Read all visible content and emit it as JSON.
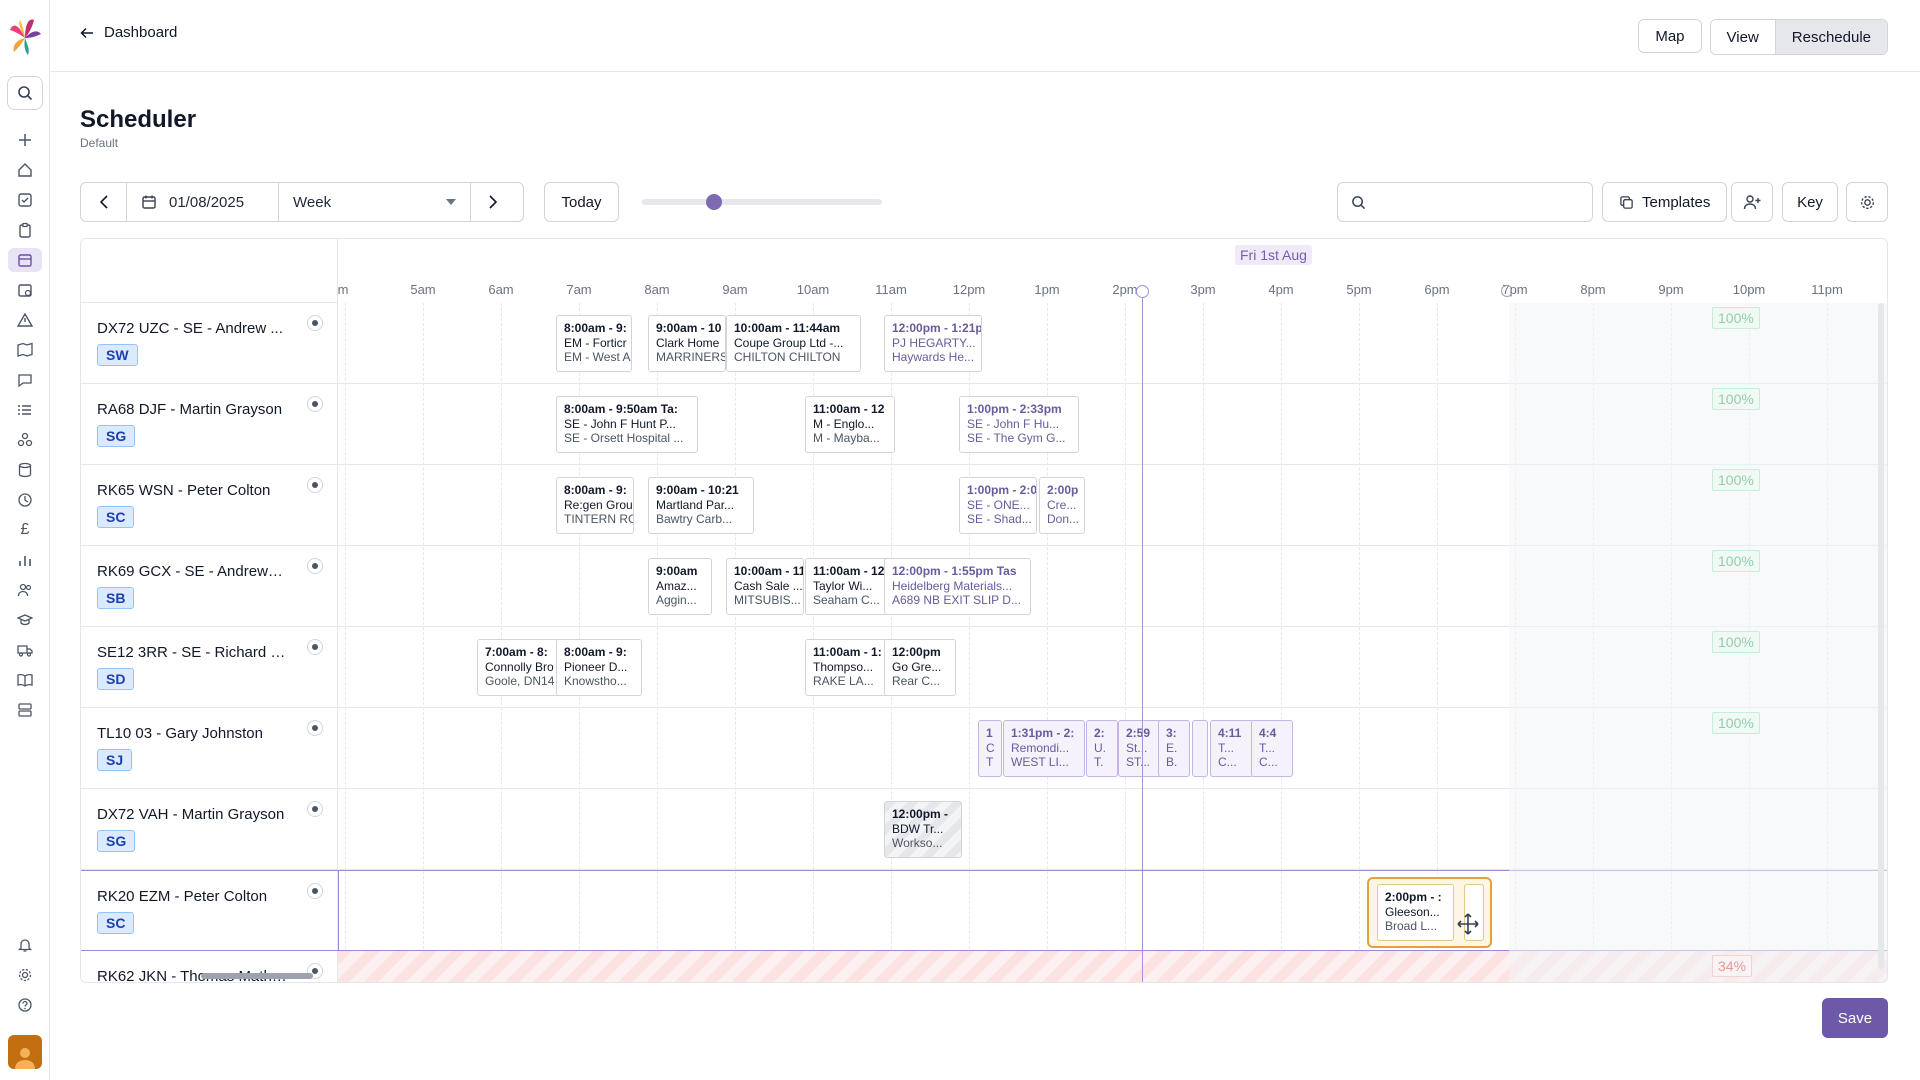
{
  "topbar": {
    "back_label": "Dashboard",
    "buttons": [
      "Map",
      "View",
      "Reschedule"
    ],
    "active_button": "Reschedule"
  },
  "page": {
    "title": "Scheduler",
    "subtitle": "Default"
  },
  "toolbar": {
    "date": "01/08/2025",
    "view_select": "Week",
    "today_label": "Today",
    "zoom_fraction": 0.3,
    "search_placeholder": "",
    "templates_label": "Templates",
    "key_label": "Key"
  },
  "timeline": {
    "day_label": "Fri 1st Aug",
    "hours": [
      "m",
      "5am",
      "6am",
      "7am",
      "8am",
      "9am",
      "10am",
      "11am",
      "12pm",
      "1pm",
      "2pm",
      "3pm",
      "4pm",
      "5pm",
      "6pm",
      "7pm",
      "8pm",
      "9pm",
      "10pm",
      "11pm"
    ]
  },
  "rows": [
    {
      "name": "DX72 UZC - SE - Andrew ...",
      "badge": "SW",
      "utilisation": "100%",
      "jobs": [
        {
          "t": "8:00am - 9:",
          "l2": "EM - Forticr",
          "l3": "EM - West A"
        },
        {
          "t": "9:00am - 10",
          "l2": "Clark Home",
          "l3": "MARRINERS"
        },
        {
          "t": "10:00am - 11:44am",
          "l2": "Coupe Group Ltd -...",
          "l3": "CHILTON CHILTON"
        },
        {
          "t": "12:00pm - 1:21p",
          "l2": "PJ HEGARTY...",
          "l3": "Haywards He..."
        }
      ]
    },
    {
      "name": "RA68 DJF - Martin Grayson",
      "badge": "SG",
      "utilisation": "100%",
      "jobs": [
        {
          "t": "8:00am - 9:50am  Ta:",
          "l2": "SE - John F Hunt P...",
          "l3": "SE - Orsett Hospital ..."
        },
        {
          "t": "11:00am - 12",
          "l2": "M - Englo...",
          "l3": "M - Mayba..."
        },
        {
          "t": "1:00pm - 2:33pm",
          "l2": "SE - John F Hu...",
          "l3": "SE - The Gym G..."
        }
      ]
    },
    {
      "name": "RK65 WSN - Peter Colton",
      "badge": "SC",
      "utilisation": "100%",
      "jobs": [
        {
          "t": "8:00am - 9:",
          "l2": "Re:gen Grou",
          "l3": "TINTERN RC"
        },
        {
          "t": "9:00am - 10:21",
          "l2": "Martland Par...",
          "l3": "Bawtry Carb..."
        },
        {
          "t": "1:00pm - 2:0",
          "l2": "SE - ONE...",
          "l3": "SE - Shad..."
        },
        {
          "t": "2:00p",
          "l2": "Cre...",
          "l3": "Don..."
        }
      ]
    },
    {
      "name": "RK69 GCX - SE - Andrew B...",
      "badge": "SB",
      "utilisation": "100%",
      "jobs": [
        {
          "t": "9:00am",
          "l2": "Amaz...",
          "l3": "Aggin..."
        },
        {
          "t": "10:00am - 11",
          "l2": "Cash Sale ...",
          "l3": "MITSUBIS..."
        },
        {
          "t": "11:00am - 12",
          "l2": "Taylor Wi...",
          "l3": "Seaham C..."
        },
        {
          "t": "12:00pm - 1:55pm  Tas",
          "l2": "Heidelberg Materials...",
          "l3": "A689 NB EXIT SLIP D..."
        }
      ]
    },
    {
      "name": "SE12 3RR - SE - Richard D...",
      "badge": "SD",
      "utilisation": "100%",
      "jobs": [
        {
          "t": "7:00am - 8:",
          "l2": "Connolly Bro",
          "l3": "Goole, DN14"
        },
        {
          "t": "8:00am - 9:",
          "l2": "Pioneer D...",
          "l3": "Knowstho..."
        },
        {
          "t": "11:00am - 1:",
          "l2": "Thompso...",
          "l3": "RAKE LA..."
        },
        {
          "t": "12:00pm",
          "l2": "Go Gre...",
          "l3": "Rear C..."
        }
      ]
    },
    {
      "name": "TL10 03 - Gary Johnston",
      "badge": "SJ",
      "utilisation": "100%",
      "jobs": [
        {
          "t": "1",
          "l2": "C",
          "l3": "T"
        },
        {
          "t": "1:31pm - 2:",
          "l2": "Remondi...",
          "l3": "WEST LI..."
        },
        {
          "t": "2:",
          "l2": "U.",
          "l3": "T."
        },
        {
          "t": "2:59",
          "l2": "St...",
          "l3": "ST..."
        },
        {
          "t": "3:",
          "l2": "E.",
          "l3": "B."
        },
        {
          "t": "",
          "l2": "",
          "l3": ""
        },
        {
          "t": "4:11",
          "l2": "T...",
          "l3": "C..."
        },
        {
          "t": "4:4",
          "l2": "T...",
          "l3": "C..."
        }
      ]
    },
    {
      "name": "DX72 VAH - Martin Grayson",
      "badge": "SG",
      "utilisation": "",
      "jobs": [
        {
          "t": "12:00pm -",
          "l2": "BDW Tr...",
          "l3": "Workso..."
        }
      ]
    },
    {
      "name": "RK20 EZM - Peter Colton",
      "badge": "SC",
      "utilisation": "",
      "jobs": [
        {
          "t": "2:00pm - :",
          "l2": "Gleeson...",
          "l3": "Broad L..."
        },
        {
          "t": "",
          "l2": "",
          "l3": ""
        }
      ]
    },
    {
      "name": "RK62 JKN - Thomas Mathe...",
      "badge": "",
      "utilisation": "34%",
      "jobs": []
    }
  ],
  "save_label": "Save",
  "colors": {
    "accent": "#6e58a8",
    "utilisation_ok": "#16a34a",
    "utilisation_low": "#dc2626",
    "drag_highlight": "#e0a33b"
  },
  "icons": [
    "app-logo-icon",
    "search-icon",
    "plus-icon",
    "home-icon",
    "checklist-icon",
    "clipboard-icon",
    "calendar-icon",
    "calendar-clock-icon",
    "warning-icon",
    "map-icon",
    "message-icon",
    "list-icon",
    "network-icon",
    "database-icon",
    "clock-icon",
    "pound-icon",
    "bar-chart-icon",
    "users-icon",
    "graduation-icon",
    "truck-icon",
    "book-icon",
    "layout-icon",
    "bell-icon",
    "gear-icon",
    "help-icon"
  ]
}
